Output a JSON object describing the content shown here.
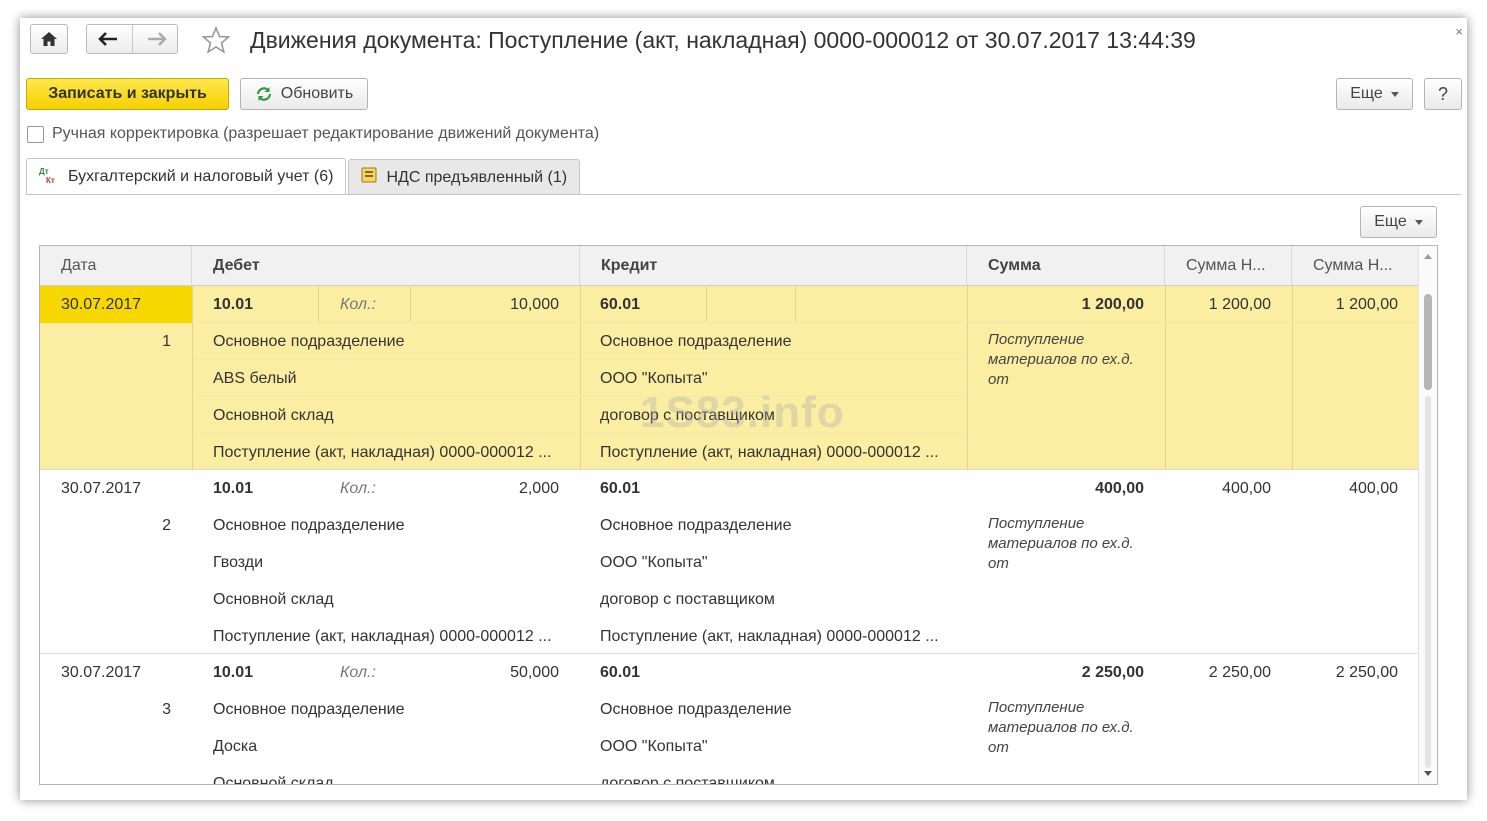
{
  "window": {
    "title": "Движения документа: Поступление (акт, накладная) 0000-000012 от 30.07.2017 13:44:39",
    "close_glyph": "×"
  },
  "toolbar": {
    "save_close": "Записать и закрыть",
    "refresh": "Обновить",
    "more": "Еще",
    "help": "?"
  },
  "manual_edit": {
    "label": "Ручная корректировка (разрешает редактирование движений документа)",
    "checked": false
  },
  "tabs": [
    {
      "label": "Бухгалтерский и налоговый учет (6)",
      "icon": "dt-kt-icon",
      "active": true
    },
    {
      "label": "НДС предъявленный (1)",
      "icon": "register-icon",
      "active": false
    }
  ],
  "table": {
    "more": "Еще",
    "columns": [
      "Дата",
      "Дебет",
      "Кредит",
      "Сумма",
      "Сумма Н...",
      "Сумма Н..."
    ],
    "rows": [
      {
        "date": "30.07.2017",
        "num": "1",
        "debit_account": "10.01",
        "qty_label": "Кол.:",
        "qty": "10,000",
        "debit_lines": [
          "Основное подразделение",
          "ABS белый",
          "Основной склад",
          "Поступление (акт, накладная) 0000-000012 ..."
        ],
        "credit_account": "60.01",
        "credit_lines": [
          "Основное подразделение",
          "ООО \"Копыта\"",
          "договор с поставщиком",
          "Поступление (акт, накладная) 0000-000012 ..."
        ],
        "sum": "1 200,00",
        "sum_n1": "1 200,00",
        "sum_n2": "1 200,00",
        "content": "Поступление материалов по ех.д.  от"
      },
      {
        "date": "30.07.2017",
        "num": "2",
        "debit_account": "10.01",
        "qty_label": "Кол.:",
        "qty": "2,000",
        "debit_lines": [
          "Основное подразделение",
          "Гвозди",
          "Основной склад",
          "Поступление (акт, накладная) 0000-000012 ..."
        ],
        "credit_account": "60.01",
        "credit_lines": [
          "Основное подразделение",
          "ООО \"Копыта\"",
          "договор с поставщиком",
          "Поступление (акт, накладная) 0000-000012 ..."
        ],
        "sum": "400,00",
        "sum_n1": "400,00",
        "sum_n2": "400,00",
        "content": "Поступление материалов по ех.д.  от"
      },
      {
        "date": "30.07.2017",
        "num": "3",
        "debit_account": "10.01",
        "qty_label": "Кол.:",
        "qty": "50,000",
        "debit_lines": [
          "Основное подразделение",
          "Доска",
          "Основной склад",
          ""
        ],
        "credit_account": "60.01",
        "credit_lines": [
          "Основное подразделение",
          "ООО \"Копыта\"",
          "договор с поставщиком",
          ""
        ],
        "sum": "2 250,00",
        "sum_n1": "2 250,00",
        "sum_n2": "2 250,00",
        "content": "Поступление материалов по ех.д.  от"
      }
    ]
  },
  "watermark": "1S83.info",
  "colors": {
    "primary_button": "#f6d000",
    "selected_row": "#fbeea3",
    "selected_date": "#f6d800"
  }
}
